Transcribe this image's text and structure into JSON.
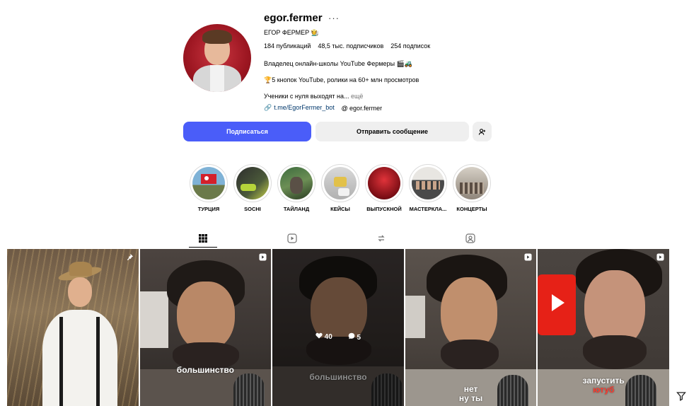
{
  "profile": {
    "username": "egor.fermer",
    "more": "···",
    "full_name": "ЕГОР ФЕРМЕР 🧑‍🌾",
    "stats": {
      "posts": "184 публикаций",
      "followers": "48,5 тыс. подписчиков",
      "following": "254 подписок"
    },
    "bio_line1": "Владелец онлайн-школы YouTube Фермеры 🎬🚜",
    "bio_line2": "🏆5 кнопок YouTube, ролики на 60+ млн просмотров",
    "bio_line3": "Ученики с нуля выходят на...",
    "bio_more": "ещё",
    "link": "t.me/EgorFermer_bot",
    "threads": "egor.fermer"
  },
  "buttons": {
    "follow": "Подписаться",
    "message": "Отправить сообщение",
    "add_icon": "add-person-icon"
  },
  "highlights": [
    {
      "label": "ТУРЦИЯ"
    },
    {
      "label": "SOCHI"
    },
    {
      "label": "ТАЙЛАНД"
    },
    {
      "label": "КЕЙСЫ"
    },
    {
      "label": "ВЫПУСКНОЙ"
    },
    {
      "label": "МАСТЕРКЛА..."
    },
    {
      "label": "КОНЦЕРТЫ"
    }
  ],
  "tabs": [
    {
      "icon": "grid-icon",
      "active": true
    },
    {
      "icon": "reels-icon",
      "active": false
    },
    {
      "icon": "reposts-icon",
      "active": false
    },
    {
      "icon": "tagged-icon",
      "active": false
    }
  ],
  "posts": [
    {
      "badge": "pin-icon",
      "caption": ""
    },
    {
      "badge": "reel-icon",
      "caption": "большинство"
    },
    {
      "badge": "reel-icon",
      "caption": "большинство",
      "likes": "40",
      "comments": "5"
    },
    {
      "badge": "reel-icon",
      "caption_line1": "нет",
      "caption_line2": "ну ты"
    },
    {
      "badge": "reel-icon",
      "caption_line1": "запустить",
      "caption_line2": "ютуб"
    }
  ],
  "colors": {
    "follow_button": "#4a5df9",
    "secondary_button": "#efefef",
    "link": "#00376b"
  }
}
